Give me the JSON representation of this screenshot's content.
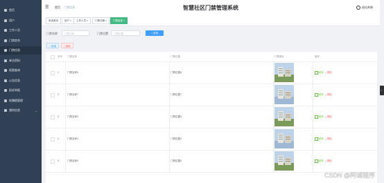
{
  "sidebar": {
    "items": [
      {
        "label": "首页",
        "icon": "home-icon"
      },
      {
        "label": "用户",
        "icon": "user-icon"
      },
      {
        "label": "工作人员",
        "icon": "user-icon"
      },
      {
        "label": "门禁综合",
        "icon": "user-icon"
      },
      {
        "label": "门禁信息",
        "icon": "door-icon"
      },
      {
        "label": "来访资料",
        "icon": "clipboard-icon"
      },
      {
        "label": "权限查询",
        "icon": "key-icon"
      },
      {
        "label": "公告信息",
        "icon": "bell-icon"
      },
      {
        "label": "投诉举报",
        "icon": "flag-icon"
      },
      {
        "label": "轮播图管理",
        "icon": "image-icon"
      },
      {
        "label": "我的信息",
        "icon": "info-icon",
        "caret": "⌄"
      }
    ]
  },
  "header": {
    "breadcrumb_home": "首页",
    "breadcrumb_sep": "/",
    "breadcrumb_current": "门禁信息",
    "title": "智慧社区门禁管理系统",
    "logout": "退出系统"
  },
  "tabs": [
    {
      "label": "系统首页"
    },
    {
      "label": "用户 ×"
    },
    {
      "label": "工作人员 ×"
    },
    {
      "label": "门禁日期 ×"
    },
    {
      "label": "门禁信息 ×"
    }
  ],
  "filters": {
    "name_label": "门禁名称",
    "name_placeholder": "门禁名称",
    "location_label": "门禁位置",
    "location_placeholder": "门禁位置",
    "search_button": "查询",
    "add_button": "新增",
    "delete_button": "删除"
  },
  "table": {
    "headers": [
      "序号",
      "门禁名称",
      "门禁位置",
      "门禁图片",
      "操作"
    ],
    "rows": [
      {
        "index": "1",
        "name": "门禁名称6",
        "location": "门禁位置6",
        "photo": "campus-building"
      },
      {
        "index": "2",
        "name": "门禁名称7",
        "location": "门禁位置7",
        "photo": "campus-building"
      },
      {
        "index": "3",
        "name": "门禁名称3",
        "location": "门禁位置3",
        "photo": "campus-building"
      },
      {
        "index": "4",
        "name": "门禁名称4",
        "location": "门禁位置4",
        "photo": "campus-building"
      },
      {
        "index": "5",
        "name": "门禁名称5",
        "location": "门禁位置5",
        "photo": "campus-building"
      }
    ],
    "edit_label": "修改",
    "delete_label": "删除"
  },
  "scroll_handle_glyph": "›",
  "watermark": "CSDN @阿诚程序",
  "colors": {
    "sidebar_bg": "#304156",
    "primary": "#409eff",
    "tab_active": "#42b983",
    "danger": "#f56c6c",
    "success": "#67c23a"
  }
}
